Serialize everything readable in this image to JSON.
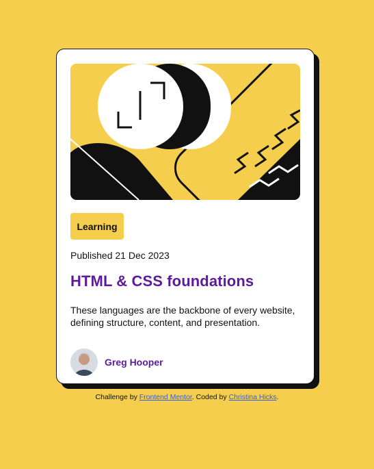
{
  "card": {
    "tag": "Learning",
    "published": "Published 21 Dec 2023",
    "title": "HTML & CSS foundations",
    "description": "These languages are the backbone of every website, defining structure, content, and presentation.",
    "author": "Greg Hooper"
  },
  "attribution": {
    "prefix": "Challenge by",
    "challenge_link": "Frontend Mentor",
    "middle": ". Coded by",
    "coder_link": "Christina Hicks",
    "suffix": "."
  },
  "colors": {
    "background": "#F4CE4C",
    "accent": "#5B1B9B",
    "card": "#FFFFFF",
    "ink": "#111111"
  },
  "icons": {
    "illustration": "abstract-shapes-illustration",
    "avatar": "author-avatar"
  }
}
